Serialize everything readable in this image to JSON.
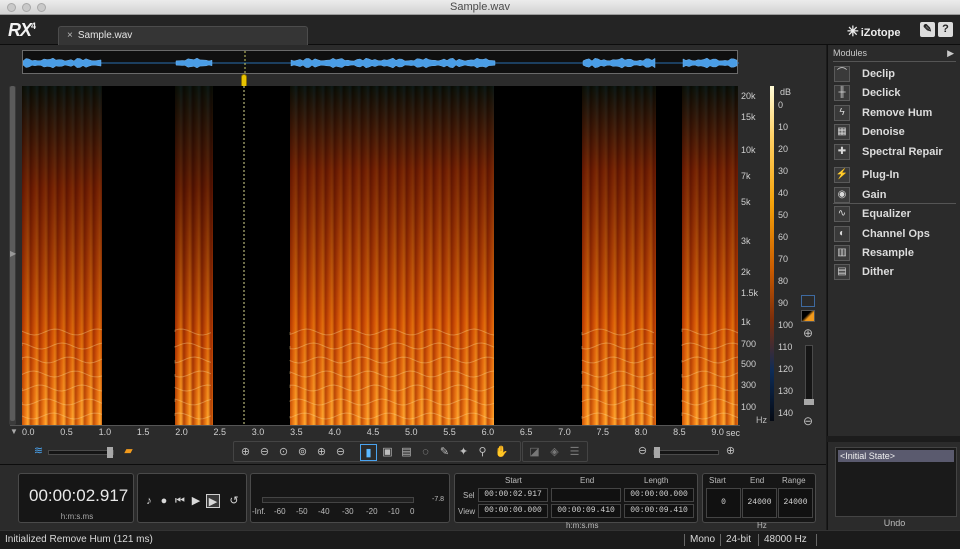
{
  "window": {
    "title": "Sample.wav"
  },
  "app": {
    "logo": "RX",
    "logo_version": "4",
    "brand": "iZotope",
    "help_label": "?"
  },
  "tabs": [
    {
      "label": "Sample.wav",
      "close": "×"
    }
  ],
  "spectrogram": {
    "freq_labels": [
      "20k",
      "15k",
      "10k",
      "7k",
      "5k",
      "3k",
      "2k",
      "1.5k",
      "1k",
      "700",
      "500",
      "300",
      "100"
    ],
    "freq_unit": "Hz",
    "db_unit": "dB",
    "db_labels": [
      "0",
      "10",
      "20",
      "30",
      "40",
      "50",
      "60",
      "70",
      "80",
      "90",
      "100",
      "110",
      "120",
      "130",
      "140"
    ],
    "time_labels": [
      "0.0",
      "0.5",
      "1.0",
      "1.5",
      "2.0",
      "2.5",
      "3.0",
      "3.5",
      "4.0",
      "4.5",
      "5.0",
      "5.5",
      "6.0",
      "6.5",
      "7.0",
      "7.5",
      "8.0",
      "8.5",
      "9.0"
    ],
    "time_unit": "sec",
    "playhead_time": 2.917,
    "colors": {
      "hot": "#ffd166",
      "mid": "#f5a30a",
      "low": "#0d2c57"
    }
  },
  "modules": {
    "header": "Modules",
    "items": [
      {
        "label": "Declip",
        "icon": "declip-icon",
        "glyph": "⌒"
      },
      {
        "label": "Declick",
        "icon": "declick-icon",
        "glyph": "╫"
      },
      {
        "label": "Remove Hum",
        "icon": "hum-icon",
        "glyph": "ϟ"
      },
      {
        "label": "Denoise",
        "icon": "denoise-icon",
        "glyph": "▦"
      },
      {
        "label": "Spectral Repair",
        "icon": "spectral-repair-icon",
        "glyph": "✚"
      },
      {
        "label": "Plug-In",
        "icon": "plugin-icon",
        "glyph": "⚡"
      },
      {
        "label": "Gain",
        "icon": "gain-icon",
        "glyph": "◉"
      },
      {
        "label": "Equalizer",
        "icon": "equalizer-icon",
        "glyph": "∿"
      },
      {
        "label": "Channel Ops",
        "icon": "channel-ops-icon",
        "glyph": "◐"
      },
      {
        "label": "Resample",
        "icon": "resample-icon",
        "glyph": "▥"
      },
      {
        "label": "Dither",
        "icon": "dither-icon",
        "glyph": "▤"
      }
    ]
  },
  "undo": {
    "state": "<Initial State>",
    "caption": "Undo"
  },
  "transport": {
    "timecode": "00:00:02.917",
    "timecode_unit": "h:m:s.ms",
    "meter_labels": [
      "-Inf.",
      "-60",
      "-50",
      "-40",
      "-30",
      "-20",
      "-10",
      "0"
    ],
    "meter_value": "-7.8"
  },
  "selection": {
    "headers": {
      "start": "Start",
      "end": "End",
      "length": "Length"
    },
    "row_labels": {
      "sel": "Sel",
      "view": "View"
    },
    "sel": {
      "start": "00:00:02.917",
      "end": "",
      "length": "00:00:00.000"
    },
    "view": {
      "start": "00:00:00.000",
      "end": "00:00:09.410",
      "length": "00:00:09.410"
    },
    "unit": "h:m:s.ms"
  },
  "freq_range": {
    "headers": {
      "start": "Start",
      "end": "End",
      "range": "Range"
    },
    "values": {
      "start": "0",
      "end": "24000",
      "range": "24000"
    },
    "unit": "Hz"
  },
  "status": {
    "message": "Initialized Remove Hum (121 ms)",
    "channels": "Mono",
    "bit_depth": "24-bit",
    "sample_rate": "48000 Hz"
  }
}
